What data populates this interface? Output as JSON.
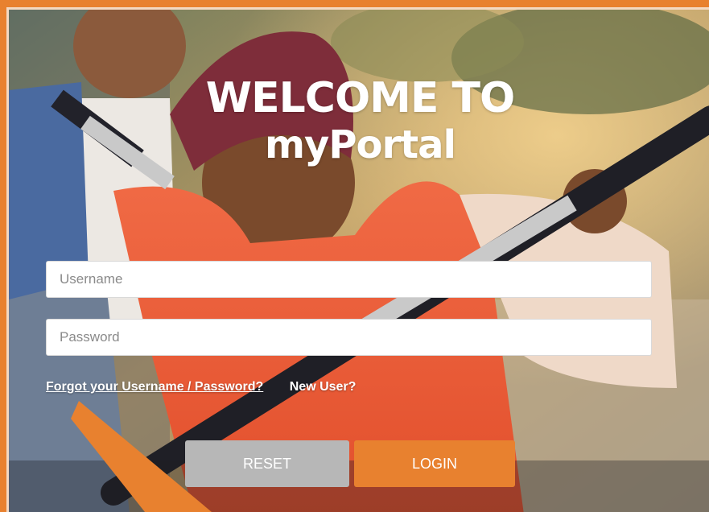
{
  "title": {
    "line1": "WELCOME TO",
    "line2": "myPortal"
  },
  "form": {
    "username_placeholder": "Username",
    "username_value": "",
    "password_placeholder": "Password",
    "password_value": ""
  },
  "links": {
    "forgot": "Forgot your Username / Password?",
    "new_user": "New User?"
  },
  "buttons": {
    "reset": "RESET",
    "login": "LOGIN"
  },
  "colors": {
    "accent": "#e8812f",
    "reset_button": "#b7b7b7",
    "frame": "#e8812f"
  }
}
